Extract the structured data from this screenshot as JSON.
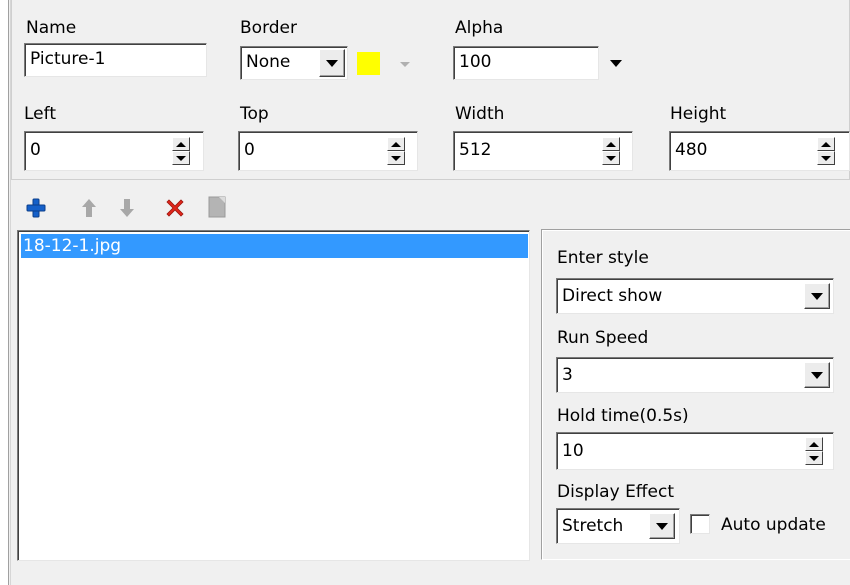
{
  "properties": {
    "name": {
      "label": "Name",
      "value": "Picture-1"
    },
    "border": {
      "label": "Border",
      "value": "None",
      "color": "#ffff00"
    },
    "alpha": {
      "label": "Alpha",
      "value": "100"
    },
    "left": {
      "label": "Left",
      "value": "0"
    },
    "top": {
      "label": "Top",
      "value": "0"
    },
    "width": {
      "label": "Width",
      "value": "512"
    },
    "height": {
      "label": "Height",
      "value": "480"
    }
  },
  "toolbar": {
    "icons": [
      "add-icon",
      "move-up-icon",
      "move-down-icon",
      "delete-icon",
      "properties-icon"
    ],
    "colors": {
      "add": "#1560c9",
      "delete": "#e0261b",
      "disabled": "#a8a8a8"
    }
  },
  "file_list": {
    "items": [
      "18-12-1.jpg"
    ],
    "selected_index": 0,
    "selection_color": "#3399ff"
  },
  "effects": {
    "enter_style": {
      "label": "Enter style",
      "value": "Direct show"
    },
    "run_speed": {
      "label": "Run Speed",
      "value": "3"
    },
    "hold_time": {
      "label": "Hold time(0.5s)",
      "value": "10"
    },
    "display_effect": {
      "label": "Display Effect",
      "value": "Stretch"
    },
    "auto_update": {
      "label": "Auto update",
      "checked": false
    }
  }
}
